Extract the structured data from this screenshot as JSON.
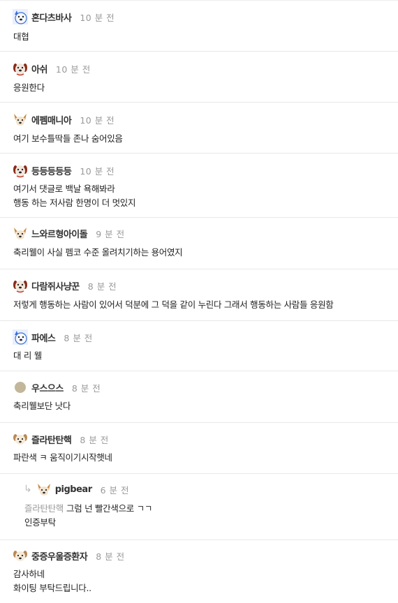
{
  "comments": [
    {
      "avatar": "blue-dog-avatar-icon",
      "nick": "혼다츠바사",
      "time": "10 분 전",
      "lines": [
        "대협"
      ]
    },
    {
      "avatar": "red-dog-avatar-icon",
      "nick": "아쉬",
      "time": "10 분 전",
      "lines": [
        "응원한다"
      ]
    },
    {
      "avatar": "corgi-avatar-icon",
      "nick": "에펨매니아",
      "time": "10 분 전",
      "lines": [
        "여기 보수틀딱들 존나 숨어있음"
      ]
    },
    {
      "avatar": "red-dog-avatar-icon",
      "nick": "등등등등등",
      "time": "10 분 전",
      "lines": [
        "여기서 댓글로 백날 욕해봐라",
        "행동 하는 저사람 한명이 더 멋있지"
      ]
    },
    {
      "avatar": "corgi-avatar-icon",
      "nick": "느와르형아이돌",
      "time": "9 분 전",
      "lines": [
        "축리웰이 사실 펨코 수준 올려치기하는 용어였지"
      ]
    },
    {
      "avatar": "red-dog-avatar-icon",
      "nick": "다람쥐사냥꾼",
      "time": "8 분 전",
      "lines": [
        "저렇게 행동하는 사람이 있어서 덕분에 그 덕을 같이 누린다 그래서 행동하는 사람들 응원함"
      ]
    },
    {
      "avatar": "blue-dog-avatar-icon",
      "nick": "파에스",
      "time": "8 분 전",
      "lines": [
        "대 리 웰"
      ]
    },
    {
      "avatar": "round-avatar-icon",
      "nick": "우스으스",
      "time": "8 분 전",
      "lines": [
        "축리웰보단 낫다"
      ]
    },
    {
      "avatar": "puppy-avatar-icon",
      "nick": "즐라탄탄핵",
      "time": "8 분 전",
      "lines": [
        "파란색 ㅋ 움직이기시작햇네"
      ]
    },
    {
      "avatar": "corgi-avatar-icon",
      "nick": "pigbear",
      "time": "6 분 전",
      "mention": "즐라탄탄핵",
      "lines": [
        "그럼 넌 빨간색으로 ㄱㄱ",
        "인증부탁"
      ],
      "reply": true
    },
    {
      "avatar": "puppy-avatar-icon",
      "nick": "중증우울증환자",
      "time": "8 분 전",
      "lines": [
        "감사하네",
        "화이팅 부탁드립니다.."
      ]
    }
  ],
  "colors": {
    "divider": "#e8e8e8",
    "time": "#999999",
    "mention": "#9a9a9a"
  }
}
